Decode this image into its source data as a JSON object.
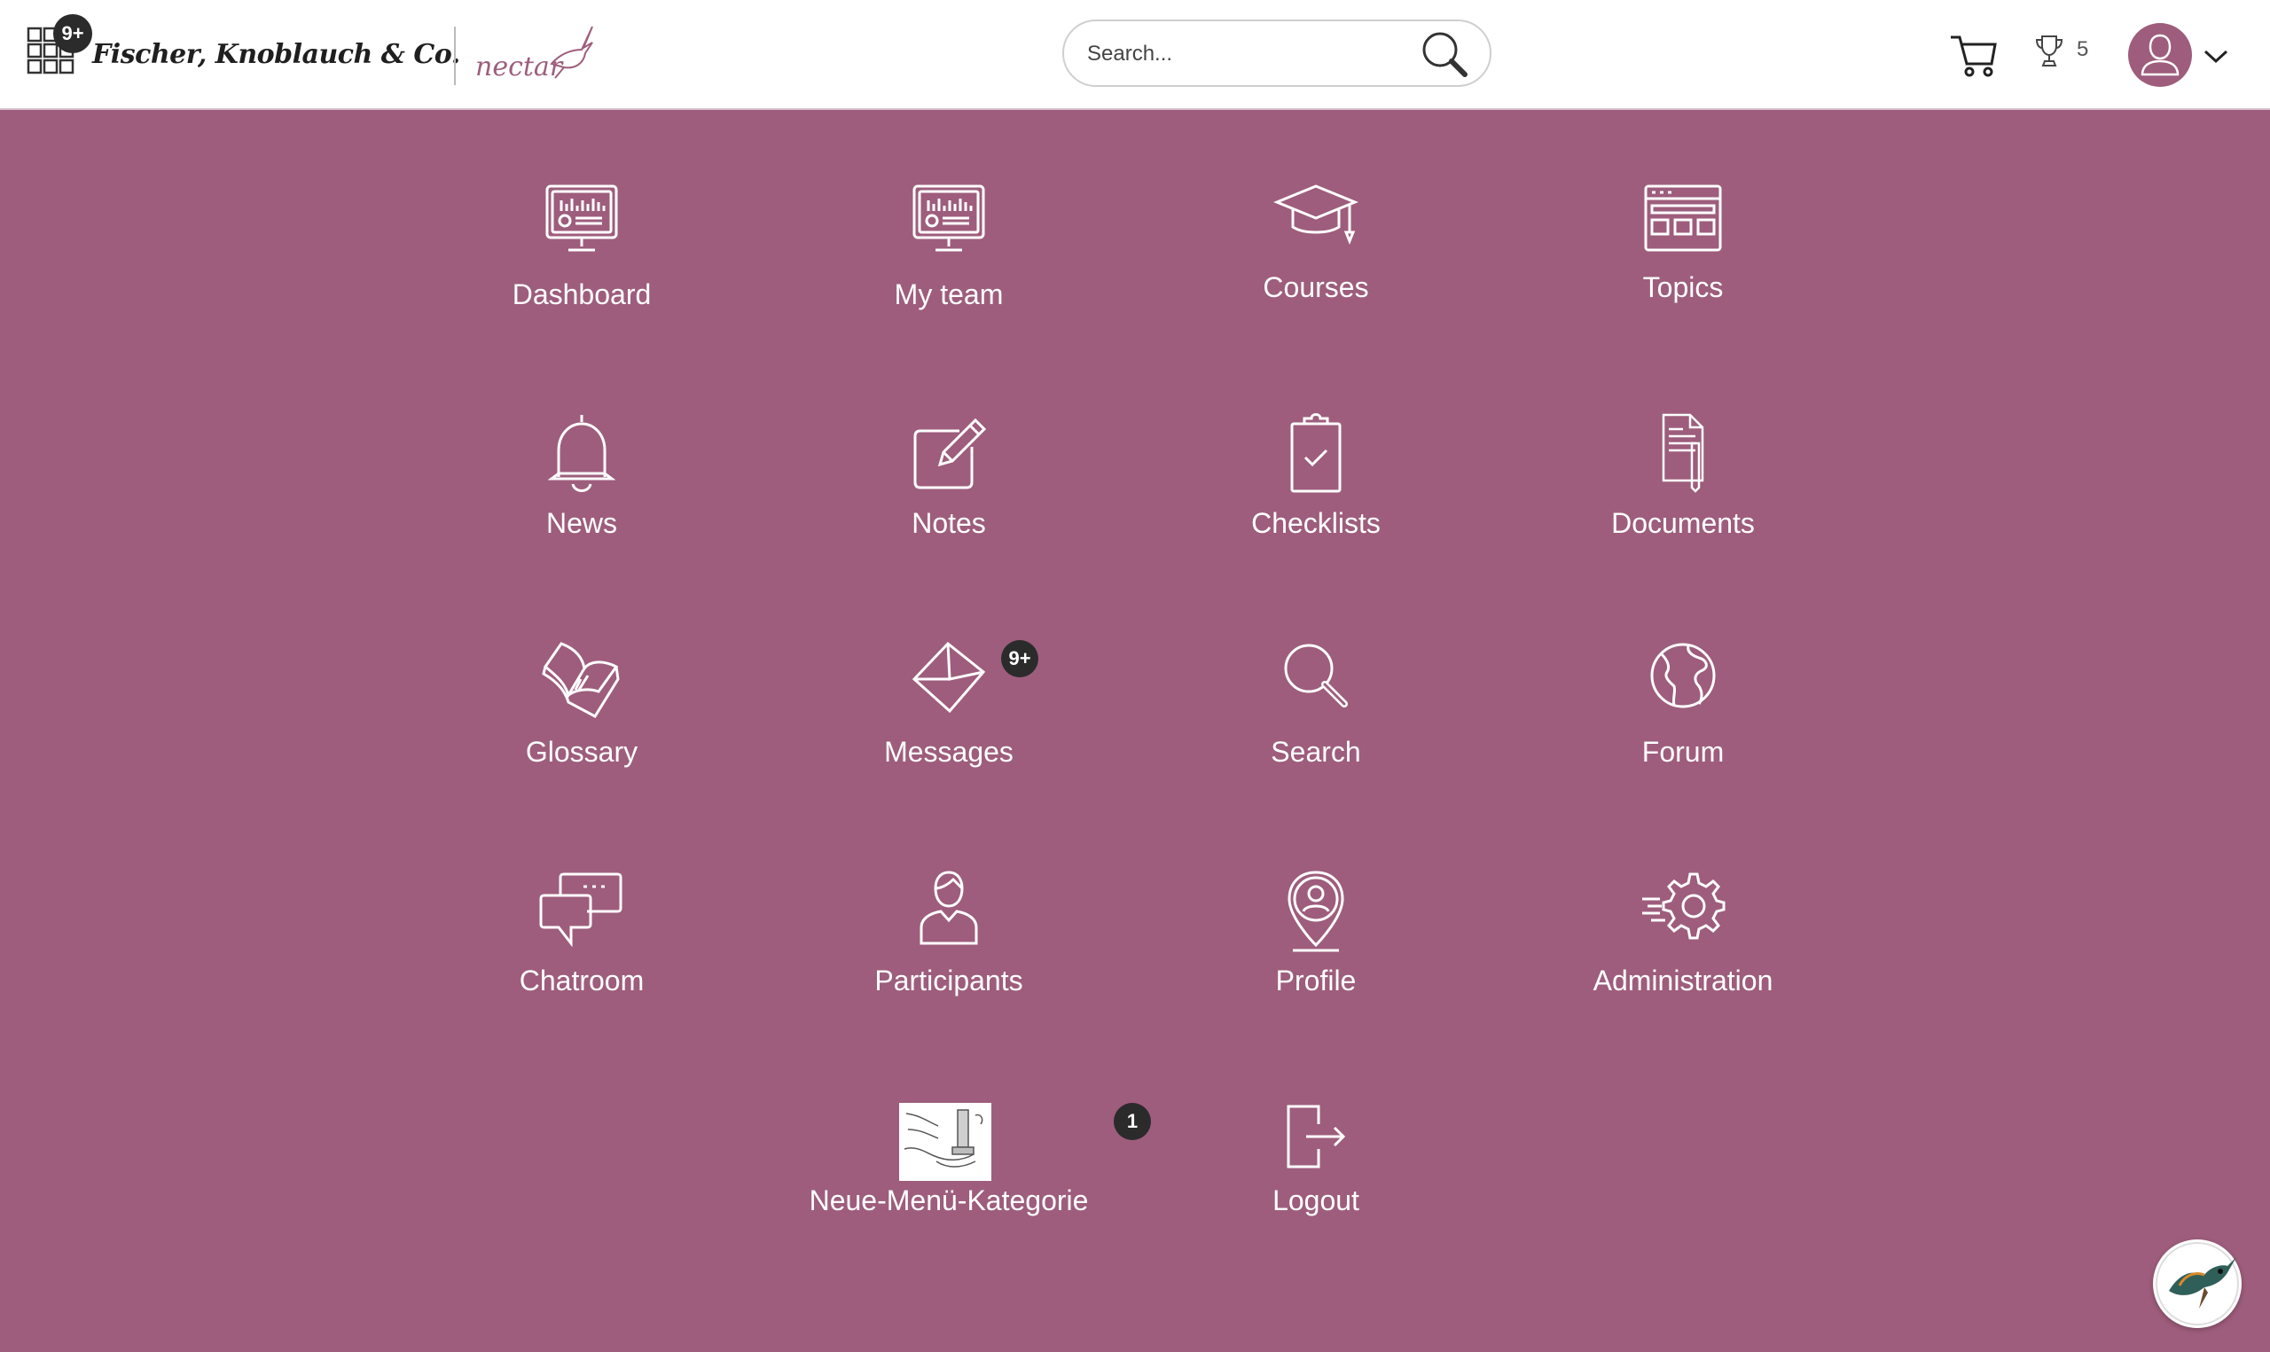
{
  "header": {
    "apps_badge": "9+",
    "company_name": "Fischer, Knoblauch & Co.",
    "product_logo": "nectar",
    "search": {
      "placeholder": "Search..."
    },
    "points": "5",
    "icons": {
      "apps": "grid-icon",
      "search": "magnifier-icon",
      "cart": "cart-icon",
      "trophy": "trophy-icon",
      "avatar": "user-icon",
      "menu": "chevron-down-icon"
    }
  },
  "menu": {
    "items": [
      {
        "label": "Dashboard",
        "icon": "monitor-chart-icon"
      },
      {
        "label": "My team",
        "icon": "monitor-chart-icon"
      },
      {
        "label": "Courses",
        "icon": "graduation-cap-icon"
      },
      {
        "label": "Topics",
        "icon": "browser-window-icon"
      },
      {
        "label": "News",
        "icon": "bell-icon"
      },
      {
        "label": "Notes",
        "icon": "pencil-note-icon"
      },
      {
        "label": "Checklists",
        "icon": "clipboard-check-icon"
      },
      {
        "label": "Documents",
        "icon": "document-pen-icon"
      },
      {
        "label": "Glossary",
        "icon": "open-book-icon"
      },
      {
        "label": "Messages",
        "icon": "envelope-icon",
        "badge": "9+"
      },
      {
        "label": "Search",
        "icon": "magnifier-icon"
      },
      {
        "label": "Forum",
        "icon": "globe-icon"
      },
      {
        "label": "Chatroom",
        "icon": "chat-bubbles-icon"
      },
      {
        "label": "Participants",
        "icon": "person-icon"
      },
      {
        "label": "Profile",
        "icon": "location-person-icon"
      },
      {
        "label": "Administration",
        "icon": "gear-icon"
      },
      {
        "label": "Neue-Menü-Kategorie",
        "icon": "category-thumbnail",
        "badge": "1"
      },
      {
        "label": "Logout",
        "icon": "logout-icon"
      }
    ]
  },
  "colors": {
    "background": "#9e5d7c",
    "header": "#ffffff",
    "badge": "#2b2b2b",
    "text_on_bg": "#ffffff"
  }
}
